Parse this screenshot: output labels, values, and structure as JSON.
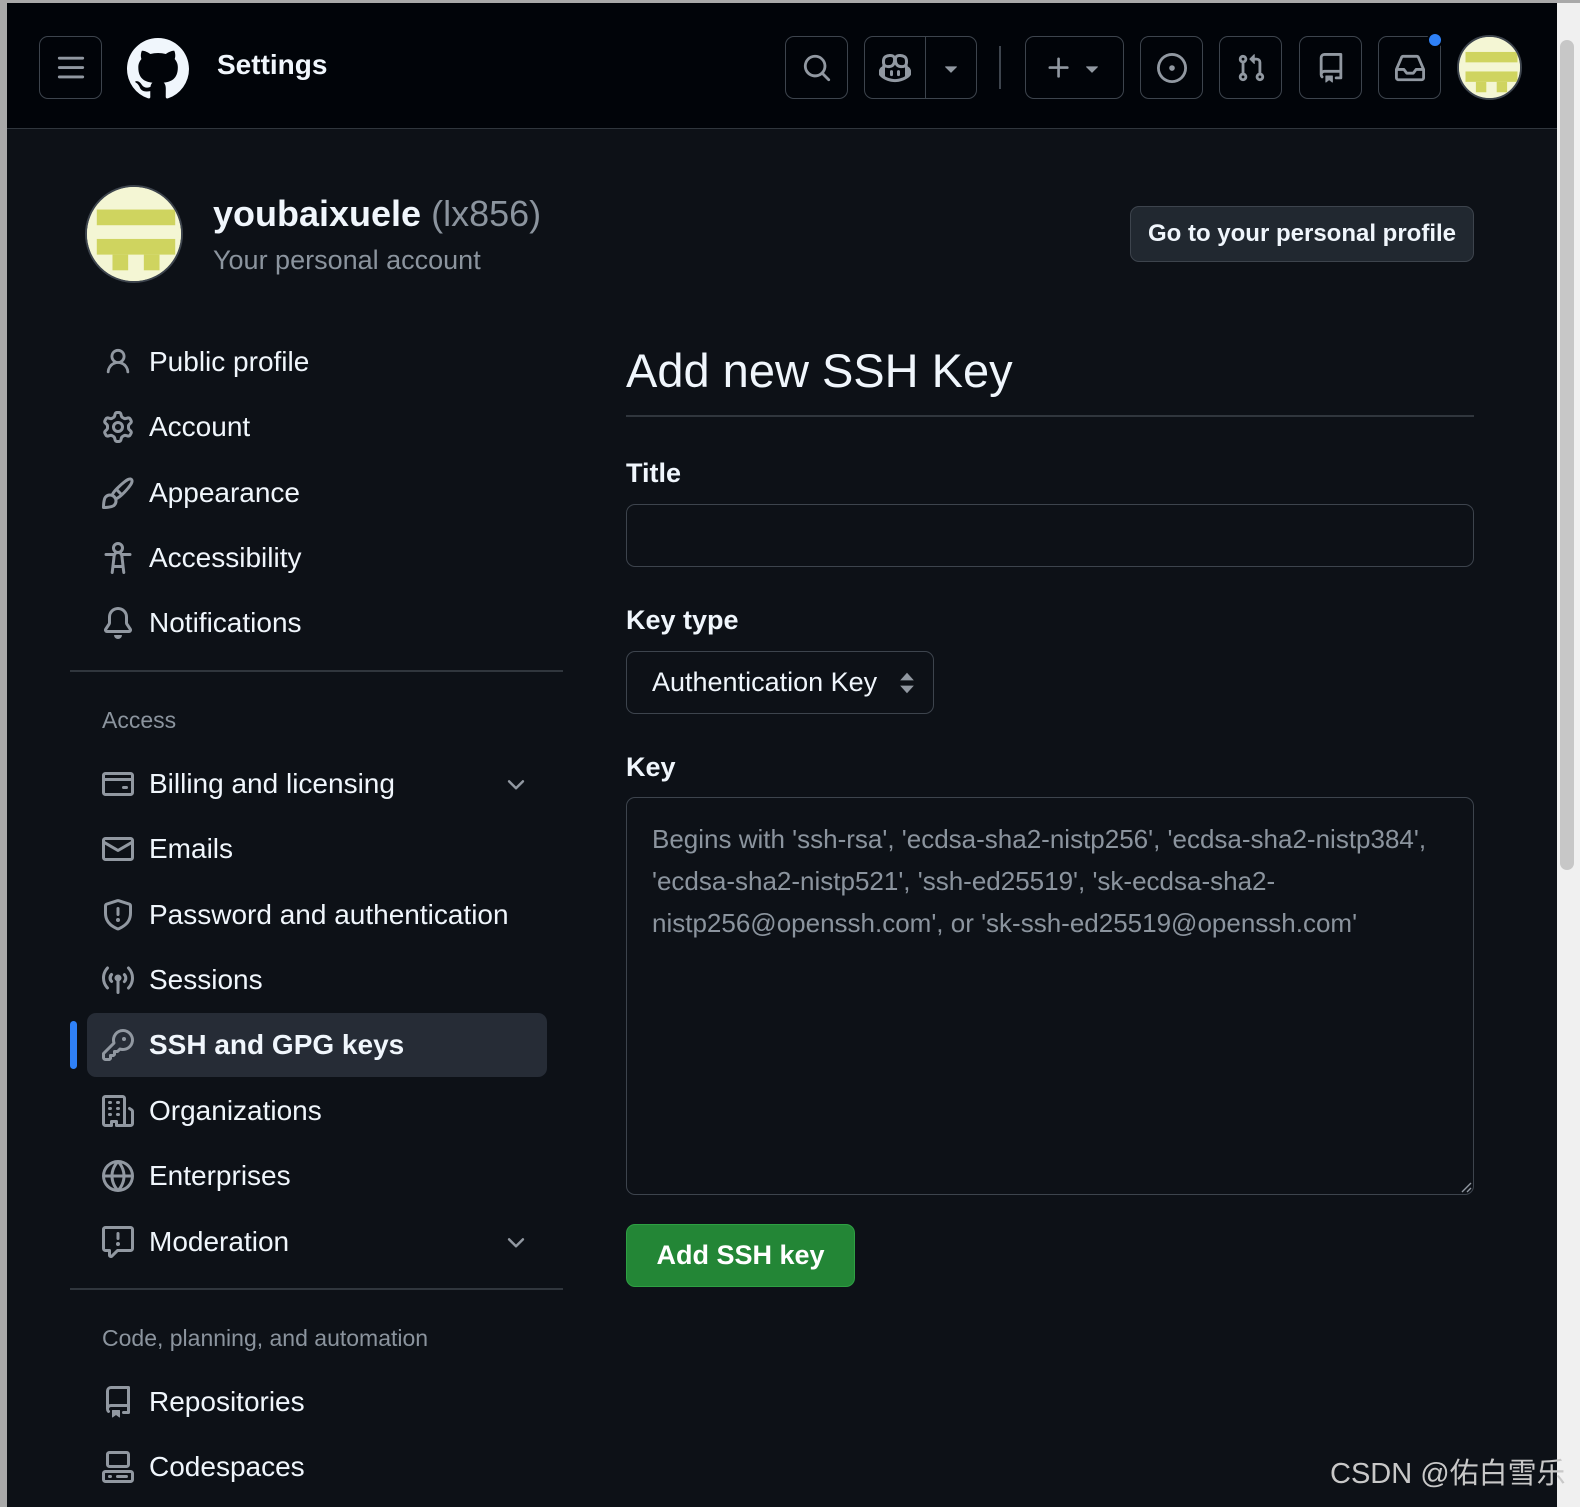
{
  "header": {
    "title": "Settings",
    "icons": [
      "hamburger-icon",
      "github-logo",
      "search-icon",
      "copilot-icon",
      "plus-icon",
      "issues-icon",
      "pull-requests-icon",
      "repo-icon",
      "inbox-icon"
    ]
  },
  "profile": {
    "display_name": "youbaixuele",
    "login": "(lx856)",
    "subtitle": "Your personal account",
    "profile_button": "Go to your personal profile"
  },
  "sidebar": {
    "group1": [
      {
        "label": "Public profile",
        "icon": "person-icon"
      },
      {
        "label": "Account",
        "icon": "gear-icon"
      },
      {
        "label": "Appearance",
        "icon": "paintbrush-icon"
      },
      {
        "label": "Accessibility",
        "icon": "accessibility-icon"
      },
      {
        "label": "Notifications",
        "icon": "bell-icon"
      }
    ],
    "access_heading": "Access",
    "group2": [
      {
        "label": "Billing and licensing",
        "icon": "credit-card-icon"
      },
      {
        "label": "Emails",
        "icon": "mail-icon"
      },
      {
        "label": "Password and authentication",
        "icon": "shield-icon"
      },
      {
        "label": "Sessions",
        "icon": "broadcast-icon"
      },
      {
        "label": "SSH and GPG keys",
        "icon": "key-icon"
      },
      {
        "label": "Organizations",
        "icon": "organization-icon"
      },
      {
        "label": "Enterprises",
        "icon": "globe-icon"
      },
      {
        "label": "Moderation",
        "icon": "report-icon"
      }
    ],
    "code_heading": "Code, planning, and automation",
    "group3": [
      {
        "label": "Repositories",
        "icon": "repo-icon"
      },
      {
        "label": "Codespaces",
        "icon": "codespaces-icon"
      }
    ]
  },
  "main": {
    "heading": "Add new SSH Key",
    "title_label": "Title",
    "title_value": "",
    "keytype_label": "Key type",
    "keytype_value": "Authentication Key",
    "key_label": "Key",
    "key_placeholder": "Begins with 'ssh-rsa', 'ecdsa-sha2-nistp256', 'ecdsa-sha2-nistp384', 'ecdsa-sha2-nistp521', 'ssh-ed25519', 'sk-ecdsa-sha2-nistp256@openssh.com', or 'sk-ssh-ed25519@openssh.com'",
    "submit_label": "Add SSH key"
  },
  "watermark": "CSDN @佑白雪乐",
  "colors": {
    "accent": "#2f81f7",
    "primary_button": "#238636",
    "background": "#0d1117",
    "header_bg": "#010409"
  }
}
